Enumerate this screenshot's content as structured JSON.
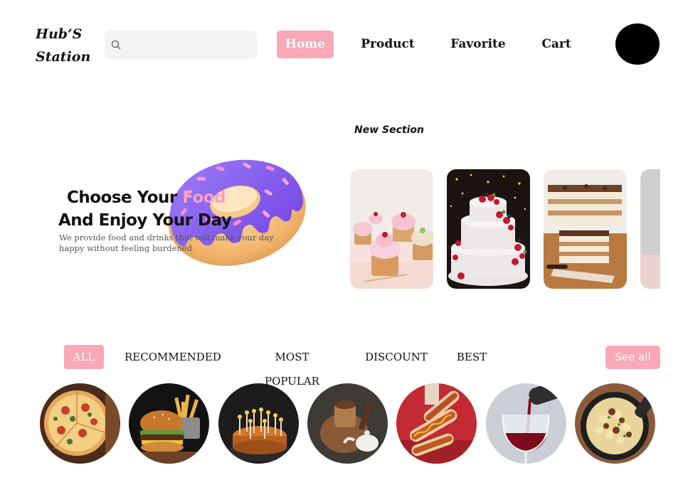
{
  "brand": {
    "logo_line1": "Hub’S",
    "logo_line2": "Station"
  },
  "search": {
    "placeholder": "",
    "value": "",
    "icon": "search-icon"
  },
  "nav": {
    "items": [
      "Home",
      "Product",
      "Favorite",
      "Cart"
    ],
    "active": "Home"
  },
  "colors": {
    "accent": "#f8a8b6",
    "accent_text": "#f7a1c2",
    "avatar": "#000000"
  },
  "hero": {
    "title_part1": "Choose Your ",
    "title_accent": "Food",
    "title_line2": "And Enjoy Your Day",
    "subtitle_line1": "We provide food and drinks that will make your day",
    "subtitle_line2": "happy without feeling burdened"
  },
  "new_section": {
    "title": "New Section",
    "cards": [
      "cupcakes",
      "berry-cake",
      "tiramisu",
      "partial-card"
    ]
  },
  "tabs": {
    "items": [
      "ALL",
      "RECOMMENDED",
      "MOST POPULAR",
      "DISCOUNT",
      "BEST"
    ],
    "active": "ALL",
    "see_all": "See all"
  },
  "categories": [
    "pizza",
    "burger-fries",
    "birthday-cake",
    "tea",
    "hot-dogs",
    "wine",
    "pasta"
  ]
}
